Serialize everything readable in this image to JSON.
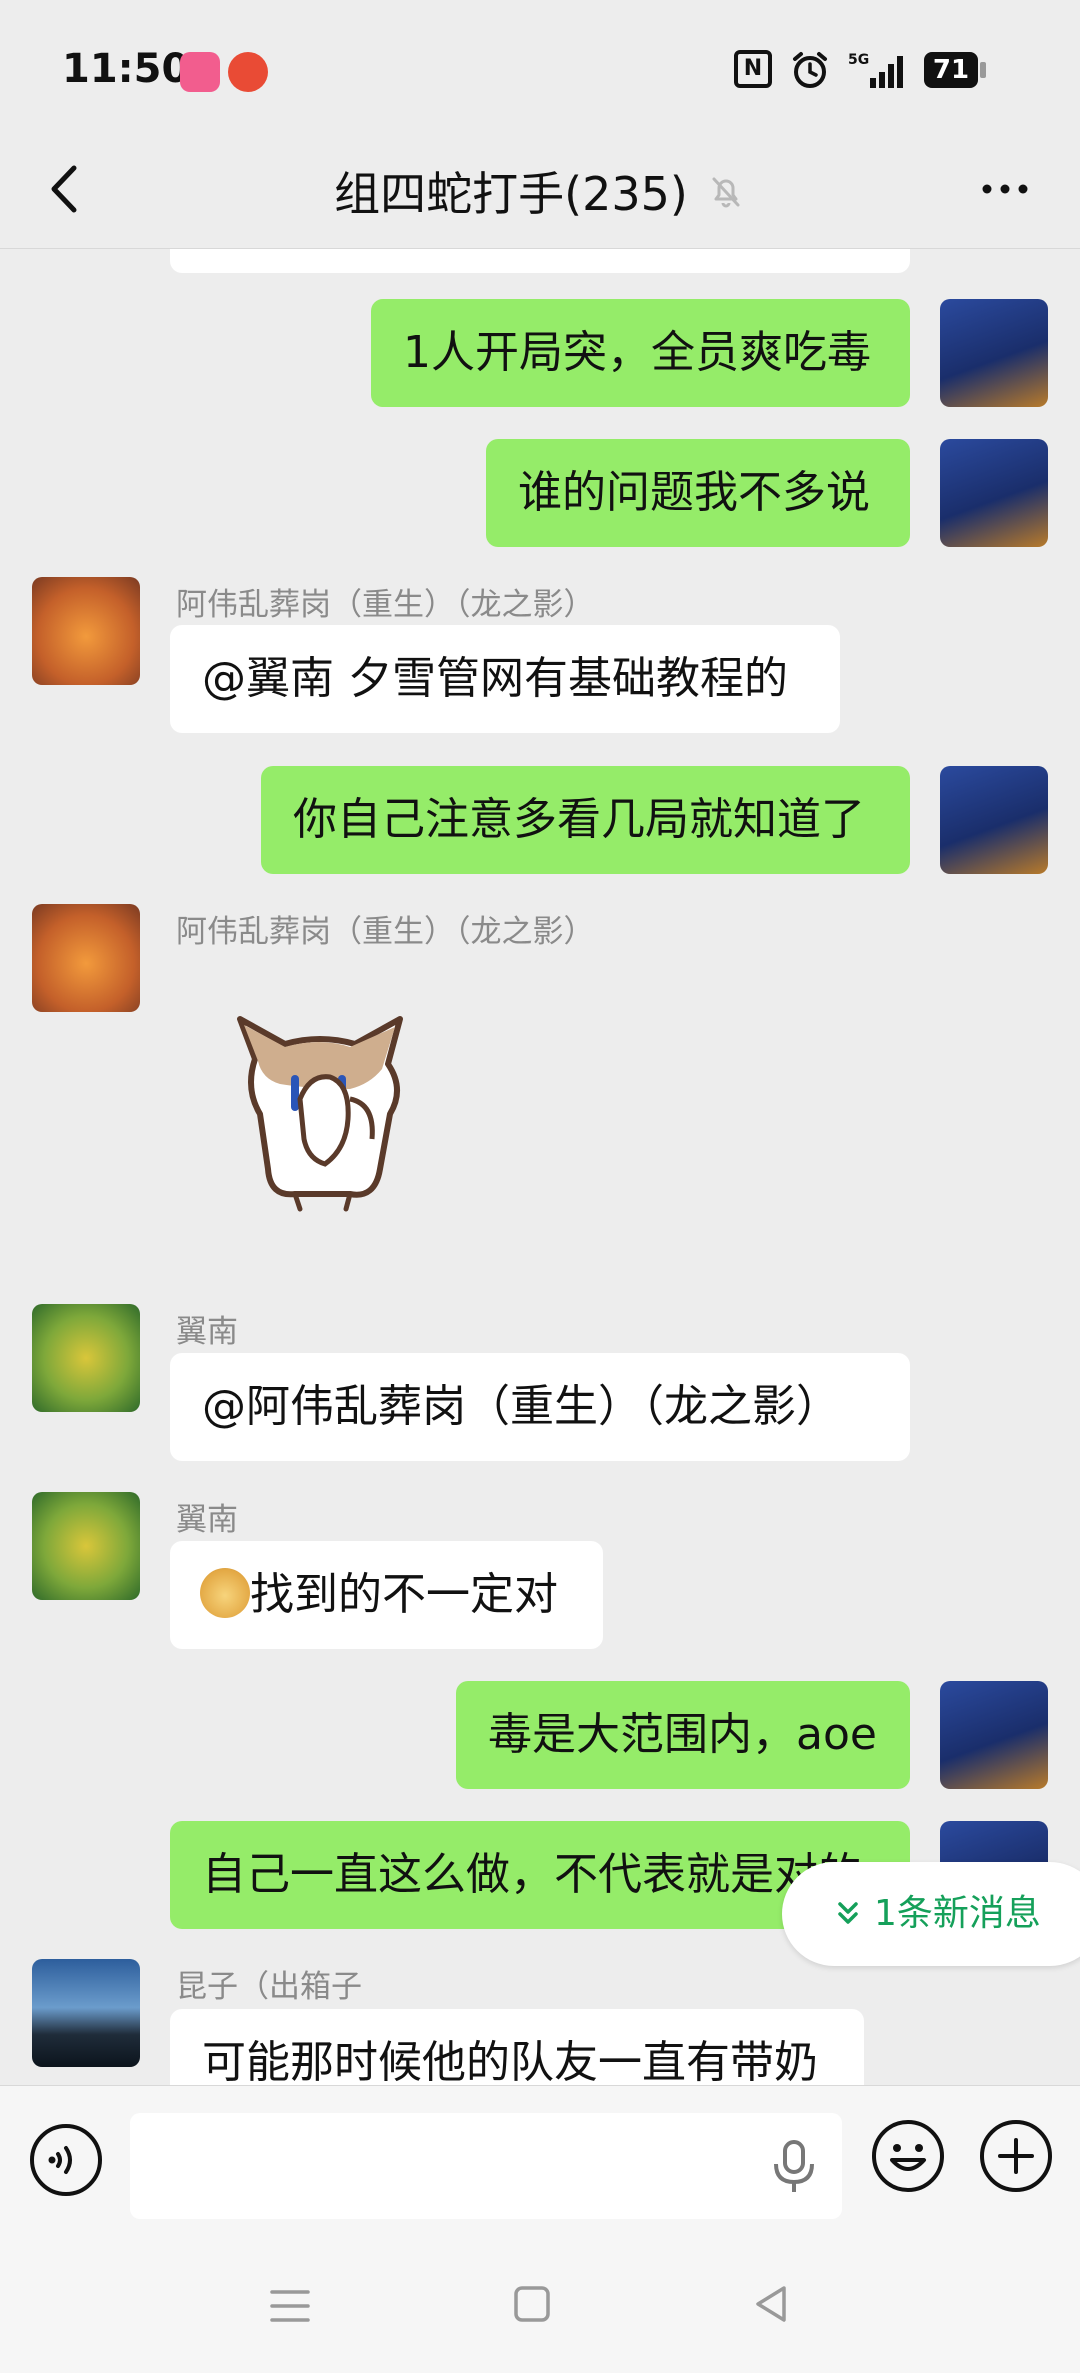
{
  "status_bar": {
    "time": "11:50",
    "network": "5G",
    "battery": "71"
  },
  "header": {
    "title": "组四蛇打手(235)",
    "back_icon": "chevron-left-icon",
    "mute_icon": "bell-off-icon",
    "more_icon": "more-dots-icon"
  },
  "messages": [
    {
      "side": "me",
      "text": "1人开局突，全员爽吃毒"
    },
    {
      "side": "me",
      "text": "谁的问题我不多说"
    },
    {
      "side": "other",
      "sender": "阿伟乱葬岗（重生）（龙之影）",
      "text": "@翼南  夕雪管网有基础教程的"
    },
    {
      "side": "me",
      "text": "你自己注意多看几局就知道了"
    },
    {
      "side": "other",
      "sender": "阿伟乱葬岗（重生）（龙之影）",
      "sticker": "cat-covering-mouth-sticker"
    },
    {
      "side": "other",
      "sender": "翼南",
      "text": "@阿伟乱葬岗（重生）（龙之影）"
    },
    {
      "side": "other",
      "sender": "翼南",
      "text": "找到的不一定对",
      "emoji": "doge-emoji"
    },
    {
      "side": "me",
      "text": "毒是大范围内，aoe"
    },
    {
      "side": "me",
      "text": "自己一直这么做，不代表就是对的"
    },
    {
      "side": "other",
      "sender": "昆子（出箱子",
      "text": "可能那时候他的队友一直有带奶"
    }
  ],
  "new_message_pill": "1条新消息",
  "input": {
    "placeholder": "",
    "value": ""
  },
  "colors": {
    "my_bubble": "#95ec69",
    "other_bubble": "#ffffff",
    "background": "#ededed",
    "accent": "#15a05a"
  }
}
